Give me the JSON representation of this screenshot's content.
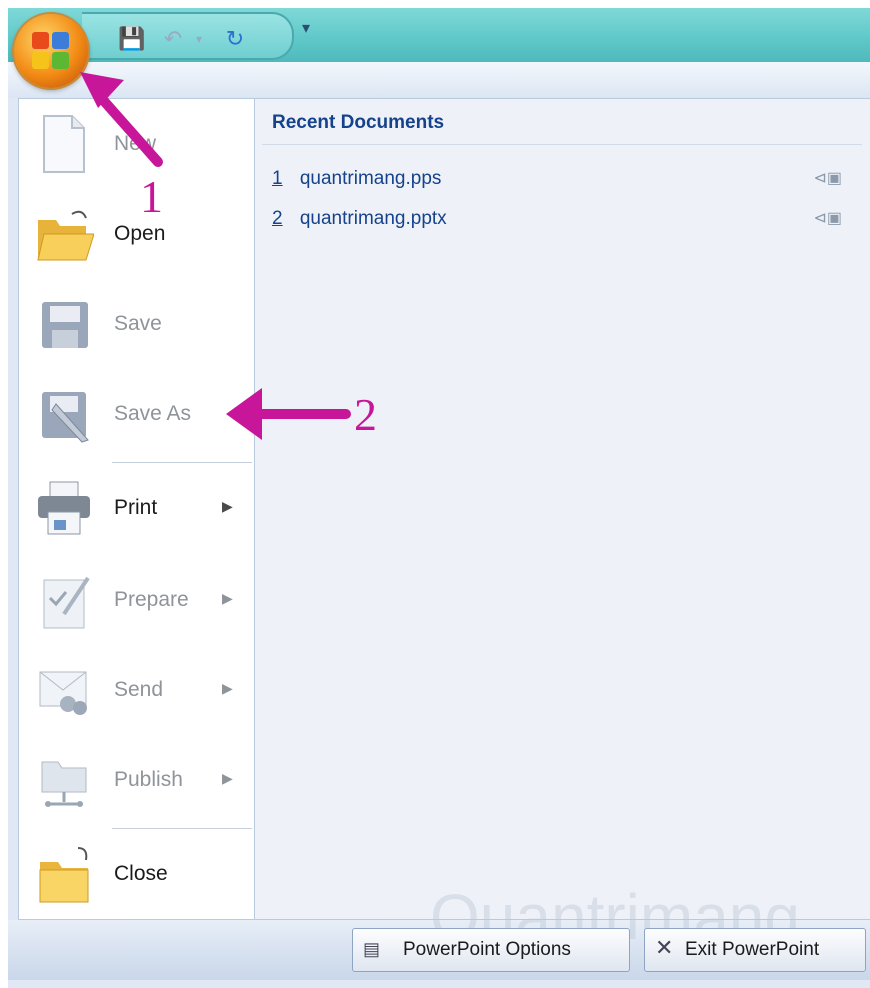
{
  "menu": {
    "items": [
      {
        "label": "New",
        "icon": "new-document-icon",
        "enabled": false,
        "submenu": false
      },
      {
        "label": "Open",
        "icon": "open-folder-icon",
        "enabled": true,
        "submenu": false
      },
      {
        "label": "Save",
        "icon": "save-disk-icon",
        "enabled": false,
        "submenu": false
      },
      {
        "label": "Save As",
        "icon": "save-as-icon",
        "enabled": false,
        "submenu": false
      },
      {
        "label": "Print",
        "icon": "printer-icon",
        "enabled": true,
        "submenu": true
      },
      {
        "label": "Prepare",
        "icon": "prepare-icon",
        "enabled": false,
        "submenu": true
      },
      {
        "label": "Send",
        "icon": "send-icon",
        "enabled": false,
        "submenu": true
      },
      {
        "label": "Publish",
        "icon": "publish-icon",
        "enabled": false,
        "submenu": true
      },
      {
        "label": "Close",
        "icon": "close-folder-icon",
        "enabled": true,
        "submenu": false
      }
    ]
  },
  "recent": {
    "title": "Recent Documents",
    "files": [
      {
        "index": "1",
        "name": "quantrimang.pps"
      },
      {
        "index": "2",
        "name": "quantrimang.pptx"
      }
    ]
  },
  "footer": {
    "options_label": "PowerPoint Options",
    "exit_label": "Exit PowerPoint"
  },
  "annotations": {
    "step1": "1",
    "step2": "2"
  },
  "watermark": "Quantrimang",
  "colors": {
    "accent_arrow": "#c8169a",
    "title_bar": "#5ec7c8",
    "recent_text": "#15428b"
  }
}
